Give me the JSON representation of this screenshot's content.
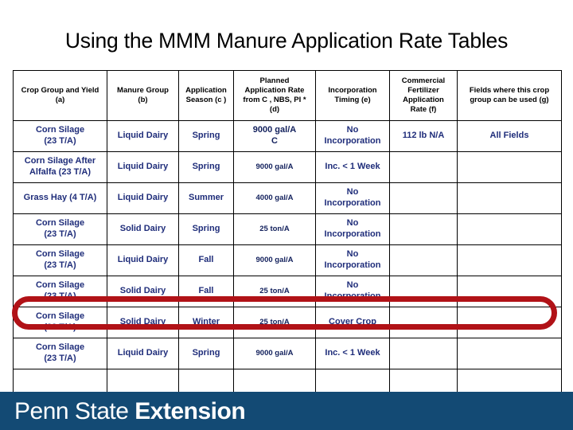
{
  "slide": {
    "title": "Using the MMM Manure Application Rate Tables"
  },
  "table": {
    "headers": [
      "Crop Group and Yield (a)",
      "Manure Group (b)",
      "Application Season (c )",
      "Planned Application Rate from C , NBS, PI * (d)",
      "Incorporation Timing (e)",
      "Commercial Fertilizer Application Rate (f)",
      "Fields where this crop group can be used (g)"
    ],
    "header_lines": [
      [
        "Crop Group and Yield",
        "(a)"
      ],
      [
        "Manure Group",
        "(b)"
      ],
      [
        "Application",
        "Season (c )"
      ],
      [
        "Planned",
        "Application Rate",
        "from C , NBS, PI *",
        "(d)"
      ],
      [
        "Incorporation",
        "Timing (e)"
      ],
      [
        "Commercial",
        "Fertilizer",
        "Application",
        "Rate (f)"
      ],
      [
        "Fields where this crop",
        "group can be used (g)"
      ]
    ],
    "rows": [
      {
        "crop_group_l1": "Corn Silage",
        "crop_group_l2": "(23 T/A)",
        "manure_group": "Liquid Dairy",
        "season": "Spring",
        "rate_l1": "9000 gal/A",
        "rate_l2": "C",
        "incorporation_l1": "No",
        "incorporation_l2": "Incorporation",
        "fertilizer": "112 lb N/A",
        "fields": "All Fields",
        "highlighted": false
      },
      {
        "crop_group_l1": "Corn Silage After",
        "crop_group_l2": "Alfalfa (23 T/A)",
        "manure_group": "Liquid Dairy",
        "season": "Spring",
        "rate_l1": "9000 gal/A",
        "rate_l2": "",
        "incorporation_l1": "Inc. < 1 Week",
        "incorporation_l2": "",
        "fertilizer": "",
        "fields": "",
        "highlighted": false
      },
      {
        "crop_group_l1": "Grass Hay (4 T/A)",
        "crop_group_l2": "",
        "manure_group": "Liquid Dairy",
        "season": "Summer",
        "rate_l1": "4000 gal/A",
        "rate_l2": "",
        "incorporation_l1": "No",
        "incorporation_l2": "Incorporation",
        "fertilizer": "",
        "fields": "",
        "highlighted": false
      },
      {
        "crop_group_l1": "Corn Silage",
        "crop_group_l2": "(23 T/A)",
        "manure_group": "Solid Dairy",
        "season": "Spring",
        "rate_l1": "25 ton/A",
        "rate_l2": "",
        "incorporation_l1": "No",
        "incorporation_l2": "Incorporation",
        "fertilizer": "",
        "fields": "",
        "highlighted": false
      },
      {
        "crop_group_l1": "Corn Silage",
        "crop_group_l2": "(23 T/A)",
        "manure_group": "Liquid Dairy",
        "season": "Fall",
        "rate_l1": "9000 gal/A",
        "rate_l2": "",
        "incorporation_l1": "No",
        "incorporation_l2": "Incorporation",
        "fertilizer": "",
        "fields": "",
        "highlighted": false
      },
      {
        "crop_group_l1": "Corn Silage",
        "crop_group_l2": "(23 T/A)",
        "manure_group": "Solid Dairy",
        "season": "Fall",
        "rate_l1": "25 ton/A",
        "rate_l2": "",
        "incorporation_l1": "No",
        "incorporation_l2": "Incorporation",
        "fertilizer": "",
        "fields": "",
        "highlighted": false
      },
      {
        "crop_group_l1": "Corn Silage",
        "crop_group_l2": "(23 T/A)",
        "manure_group": "Solid Dairy",
        "season": "Winter",
        "rate_l1": "25 ton/A",
        "rate_l2": "",
        "incorporation_l1": "Cover Crop",
        "incorporation_l2": "",
        "fertilizer": "",
        "fields": "",
        "highlighted": true
      },
      {
        "crop_group_l1": "Corn Silage",
        "crop_group_l2": "(23 T/A)",
        "manure_group": "Liquid Dairy",
        "season": "Spring",
        "rate_l1": "9000 gal/A",
        "rate_l2": "",
        "incorporation_l1": "Inc. < 1 Week",
        "incorporation_l2": "",
        "fertilizer": "",
        "fields": "",
        "highlighted": false
      },
      {
        "crop_group_l1": "",
        "crop_group_l2": "",
        "manure_group": "",
        "season": "",
        "rate_l1": "",
        "rate_l2": "",
        "incorporation_l1": "",
        "incorporation_l2": "",
        "fertilizer": "",
        "fields": "",
        "highlighted": false
      }
    ]
  },
  "footer": {
    "brand_regular": "Penn State ",
    "brand_bold": "Extension"
  },
  "colors": {
    "table_text": "#1f2d7a",
    "header_text": "#000000",
    "highlight_red": "#b11217",
    "footer_blue": "#134a74"
  }
}
